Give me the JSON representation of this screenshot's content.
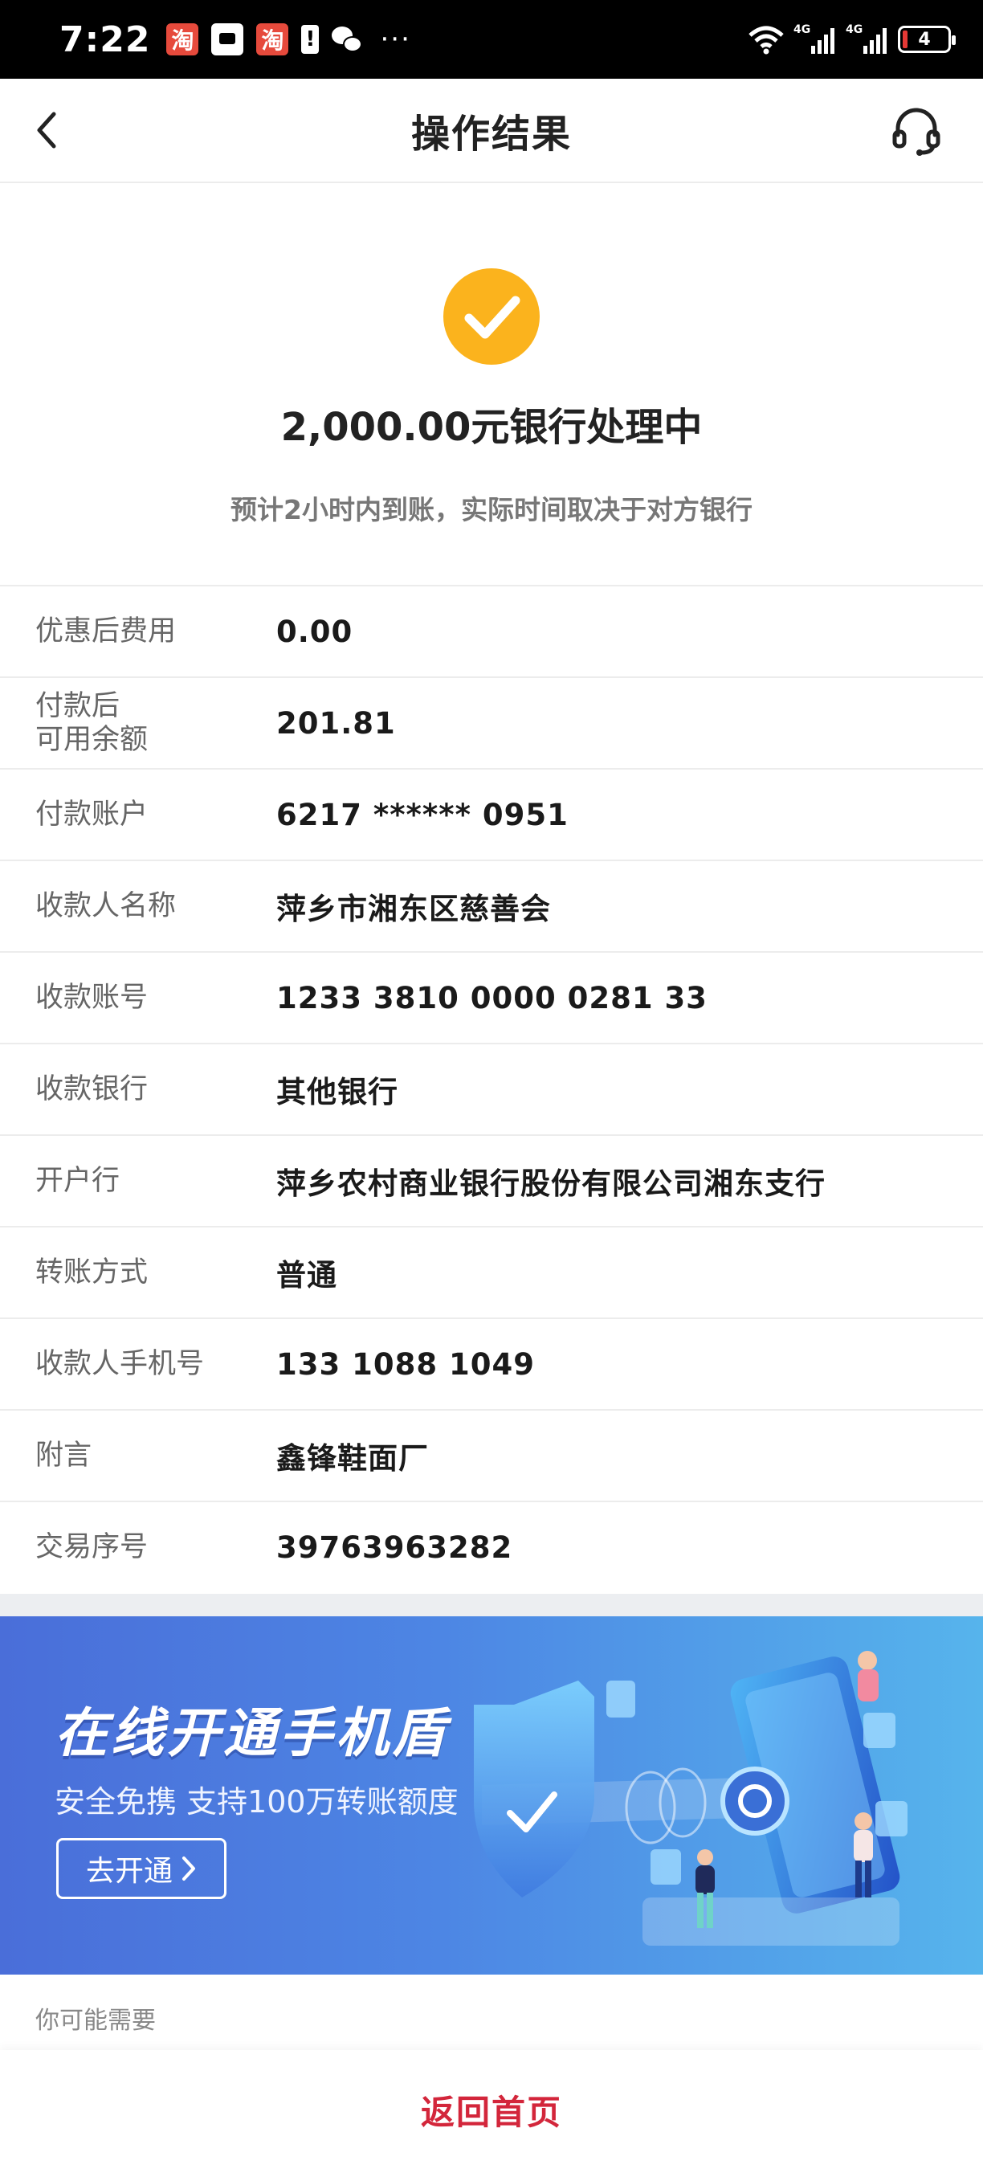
{
  "status_bar": {
    "time": "7:22",
    "app_badge": "淘",
    "alert_glyph": "!",
    "more": "···",
    "network_tag_1": "4G",
    "network_tag_2": "4G",
    "battery_level": "4"
  },
  "header": {
    "title": "操作结果"
  },
  "result": {
    "amount_status": "2,000.00元银行处理中",
    "note": "预计2小时内到账，实际时间取决于对方银行"
  },
  "details": [
    {
      "label": "优惠后费用",
      "value": "0.00"
    },
    {
      "label": "付款后\n可用余额",
      "value": "201.81"
    },
    {
      "label": "付款账户",
      "value": "6217 ****** 0951"
    },
    {
      "label": "收款人名称",
      "value": "萍乡市湘东区慈善会"
    },
    {
      "label": "收款账号",
      "value": "1233 3810 0000 0281 33"
    },
    {
      "label": "收款银行",
      "value": "其他银行"
    },
    {
      "label": "开户行",
      "value": "萍乡农村商业银行股份有限公司湘东支行"
    },
    {
      "label": "转账方式",
      "value": "普通"
    },
    {
      "label": "收款人手机号",
      "value": "133 1088 1049"
    },
    {
      "label": "附言",
      "value": "鑫锋鞋面厂"
    },
    {
      "label": "交易序号",
      "value": "39763963282"
    }
  ],
  "banner": {
    "title": "在线开通手机盾",
    "subtitle": "安全免携 支持100万转账额度",
    "button_label": "去开通"
  },
  "section": {
    "label": "你可能需要"
  },
  "footer": {
    "home_label": "返回首页"
  },
  "colors": {
    "accent": "#d3263b",
    "check": "#fbb31d"
  }
}
